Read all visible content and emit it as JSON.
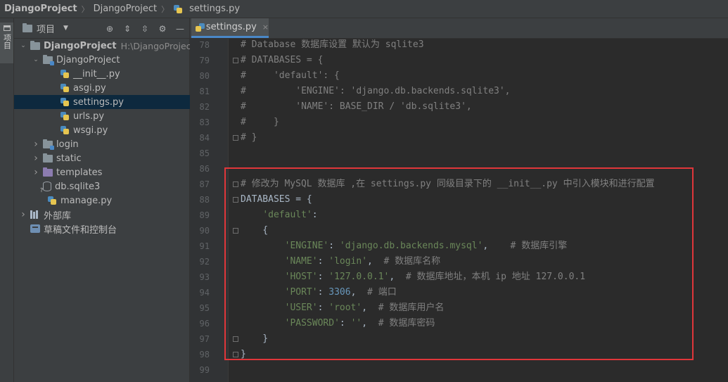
{
  "breadcrumb": [
    "DjangoProject",
    "DjangoProject",
    "settings.py"
  ],
  "left_strip": {
    "tab_label": "项目"
  },
  "project_panel": {
    "title": "项目",
    "tree": [
      {
        "label": "DjangoProject",
        "hint": "H:\\DjangoProject",
        "type": "folder",
        "expanded": true,
        "indent": 0
      },
      {
        "label": "DjangoProject",
        "type": "module-folder",
        "expanded": true,
        "indent": 1
      },
      {
        "label": "__init__.py",
        "type": "py",
        "indent": 2
      },
      {
        "label": "asgi.py",
        "type": "py",
        "indent": 2
      },
      {
        "label": "settings.py",
        "type": "py",
        "indent": 2,
        "selected": true
      },
      {
        "label": "urls.py",
        "type": "py",
        "indent": 2
      },
      {
        "label": "wsgi.py",
        "type": "py",
        "indent": 2
      },
      {
        "label": "login",
        "type": "module-folder",
        "expanded": false,
        "indent": 1
      },
      {
        "label": "static",
        "type": "folder",
        "expanded": false,
        "indent": 1
      },
      {
        "label": "templates",
        "type": "template-folder",
        "expanded": false,
        "indent": 1
      },
      {
        "label": "db.sqlite3",
        "type": "db",
        "indent": 1
      },
      {
        "label": "manage.py",
        "type": "py",
        "indent": 1
      },
      {
        "label": "外部库",
        "type": "lib",
        "expanded": false,
        "indent": 0
      },
      {
        "label": "草稿文件和控制台",
        "type": "scratch",
        "indent": 0
      }
    ]
  },
  "editor": {
    "tab_label": "settings.py",
    "lines": [
      {
        "num": "78",
        "parts": [
          {
            "t": "# Database 数据库设置 默认为 sqlite3",
            "c": "c"
          }
        ]
      },
      {
        "num": "79",
        "parts": [
          {
            "t": "# DATABASES = {",
            "c": "c"
          }
        ]
      },
      {
        "num": "80",
        "parts": [
          {
            "t": "#     'default': {",
            "c": "c"
          }
        ]
      },
      {
        "num": "81",
        "parts": [
          {
            "t": "#         'ENGINE': 'django.db.backends.sqlite3',",
            "c": "c"
          }
        ]
      },
      {
        "num": "82",
        "parts": [
          {
            "t": "#         'NAME': BASE_DIR / 'db.sqlite3',",
            "c": "c"
          }
        ]
      },
      {
        "num": "83",
        "parts": [
          {
            "t": "#     }",
            "c": "c"
          }
        ]
      },
      {
        "num": "84",
        "parts": [
          {
            "t": "# }",
            "c": "c"
          }
        ]
      },
      {
        "num": "85",
        "parts": []
      },
      {
        "num": "86",
        "parts": []
      },
      {
        "num": "87",
        "parts": [
          {
            "t": "# 修改为 MySQL 数据库 ,在 settings.py 同级目录下的 __init__.py 中引入模块和进行配置",
            "c": "c"
          }
        ]
      },
      {
        "num": "88",
        "parts": [
          {
            "t": "DATABASES = {",
            "c": "k"
          }
        ]
      },
      {
        "num": "89",
        "parts": [
          {
            "t": "    ",
            "c": "k"
          },
          {
            "t": "'default'",
            "c": "s"
          },
          {
            "t": ":",
            "c": "k"
          }
        ]
      },
      {
        "num": "90",
        "parts": [
          {
            "t": "    {",
            "c": "k"
          }
        ]
      },
      {
        "num": "91",
        "parts": [
          {
            "t": "        ",
            "c": "k"
          },
          {
            "t": "'ENGINE'",
            "c": "s"
          },
          {
            "t": ": ",
            "c": "k"
          },
          {
            "t": "'django.db.backends.mysql'",
            "c": "s"
          },
          {
            "t": ",    ",
            "c": "k"
          },
          {
            "t": "# 数据库引擎",
            "c": "c"
          }
        ]
      },
      {
        "num": "92",
        "parts": [
          {
            "t": "        ",
            "c": "k"
          },
          {
            "t": "'NAME'",
            "c": "s"
          },
          {
            "t": ": ",
            "c": "k"
          },
          {
            "t": "'login'",
            "c": "s"
          },
          {
            "t": ",  ",
            "c": "k"
          },
          {
            "t": "# 数据库名称",
            "c": "c"
          }
        ]
      },
      {
        "num": "93",
        "parts": [
          {
            "t": "        ",
            "c": "k"
          },
          {
            "t": "'HOST'",
            "c": "s"
          },
          {
            "t": ": ",
            "c": "k"
          },
          {
            "t": "'127.0.0.1'",
            "c": "s"
          },
          {
            "t": ",  ",
            "c": "k"
          },
          {
            "t": "# 数据库地址，本机 ip 地址 127.0.0.1",
            "c": "c"
          }
        ]
      },
      {
        "num": "94",
        "parts": [
          {
            "t": "        ",
            "c": "k"
          },
          {
            "t": "'PORT'",
            "c": "s"
          },
          {
            "t": ": ",
            "c": "k"
          },
          {
            "t": "3306",
            "c": "n"
          },
          {
            "t": ",  ",
            "c": "k"
          },
          {
            "t": "# 端口",
            "c": "c"
          }
        ]
      },
      {
        "num": "95",
        "parts": [
          {
            "t": "        ",
            "c": "k"
          },
          {
            "t": "'USER'",
            "c": "s"
          },
          {
            "t": ": ",
            "c": "k"
          },
          {
            "t": "'root'",
            "c": "s"
          },
          {
            "t": ",  ",
            "c": "k"
          },
          {
            "t": "# 数据库用户名",
            "c": "c"
          }
        ]
      },
      {
        "num": "96",
        "parts": [
          {
            "t": "        ",
            "c": "k"
          },
          {
            "t": "'PASSWORD'",
            "c": "s"
          },
          {
            "t": ": ",
            "c": "k"
          },
          {
            "t": "''",
            "c": "s"
          },
          {
            "t": ",  ",
            "c": "k"
          },
          {
            "t": "# 数据库密码",
            "c": "c"
          }
        ]
      },
      {
        "num": "97",
        "parts": [
          {
            "t": "    }",
            "c": "k"
          }
        ]
      },
      {
        "num": "98",
        "parts": [
          {
            "t": "}",
            "c": "k"
          }
        ]
      },
      {
        "num": "99",
        "parts": []
      }
    ]
  },
  "colors": {
    "highlight_box": "#e0363a",
    "comment": "#808080",
    "string": "#6a8759",
    "number": "#6897bb"
  }
}
